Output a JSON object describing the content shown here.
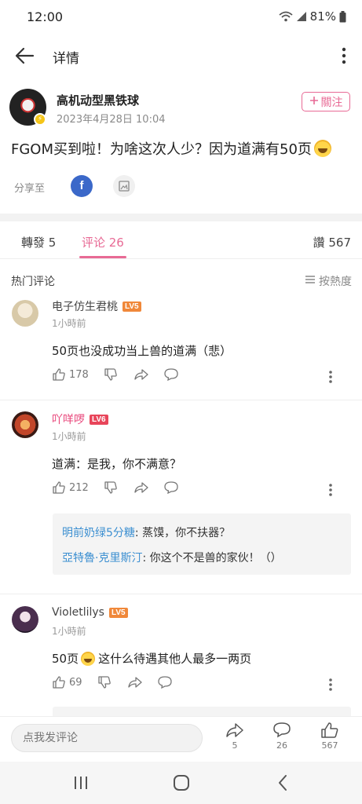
{
  "status": {
    "time": "12:00",
    "battery": "81%"
  },
  "app_bar": {
    "title": "详情"
  },
  "post": {
    "author": "高机动型黑铁球",
    "date": "2023年4月28日 10:04",
    "follow_label": "關注",
    "text": "FGOM买到啦！为啥这次人少？因为道满有50页",
    "share_label": "分享至"
  },
  "tabs": {
    "repost": "轉發 5",
    "comment": "评论 26",
    "like": "讚 567"
  },
  "hot": {
    "title": "热门评论",
    "sort": "按熱度"
  },
  "comments": [
    {
      "name": "电子仿生君桃",
      "level": "LV5",
      "time": "1小時前",
      "text": "50页也没成功当上兽的道满（悲）",
      "likes": "178"
    },
    {
      "name": "吖咩啰",
      "level": "LV6",
      "time": "1小時前",
      "text": "道满：是我，你不满意？",
      "likes": "212",
      "replies": [
        {
          "user": "明前奶绿5分糖",
          "text": ": 蒸馍，你不扶器？"
        },
        {
          "user": "亞特魯·克里斯汀",
          "text": ": 你这个不是兽的家伙！（）"
        }
      ]
    },
    {
      "name": "Violetlilys",
      "level": "LV5",
      "time": "1小時前",
      "text_before": "50页",
      "text_after": "这什么待遇其他人最多一两页",
      "likes": "69"
    }
  ],
  "bottom_bar": {
    "placeholder": "点我发评论",
    "share_count": "5",
    "comment_count": "26",
    "like_count": "567"
  },
  "colors": {
    "accent": "#e86a95",
    "link": "#3c8fd1"
  }
}
